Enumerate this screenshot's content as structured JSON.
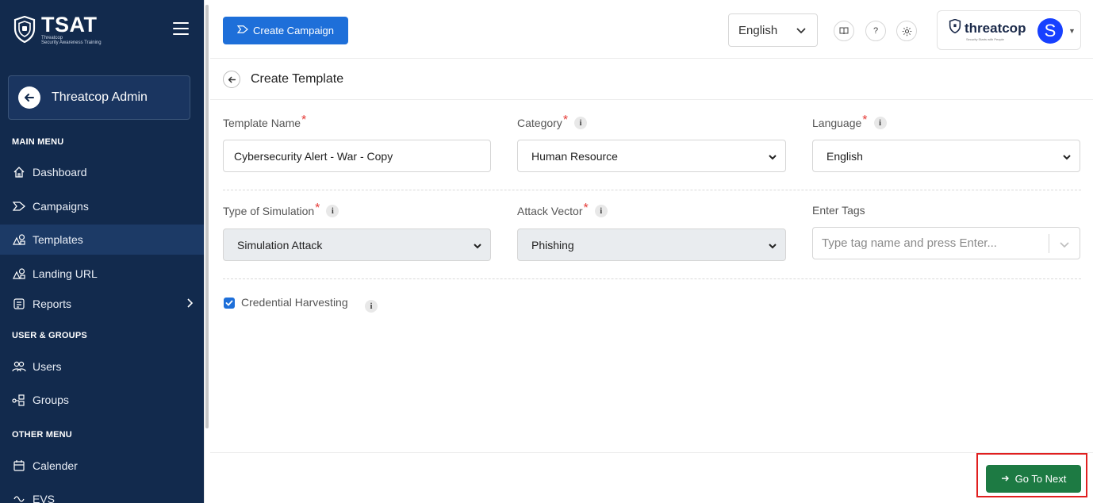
{
  "brand": {
    "name": "TSAT",
    "sub_line1": "Threatcop",
    "sub_line2": "Security Awareness Training"
  },
  "admin": {
    "label": "Threatcop Admin"
  },
  "sidebar": {
    "main_heading": "MAIN MENU",
    "main_items": [
      {
        "label": "Dashboard",
        "icon": "home-icon"
      },
      {
        "label": "Campaigns",
        "icon": "campaign-icon"
      },
      {
        "label": "Templates",
        "icon": "templates-icon",
        "active": true
      },
      {
        "label": "Landing URL",
        "icon": "landing-icon"
      },
      {
        "label": "Reports",
        "icon": "reports-icon"
      }
    ],
    "users_heading": "USER & GROUPS",
    "users_items": [
      {
        "label": "Users",
        "icon": "users-icon"
      },
      {
        "label": "Groups",
        "icon": "groups-icon"
      }
    ],
    "other_heading": "OTHER MENU",
    "other_items": [
      {
        "label": "Calender",
        "icon": "calendar-icon"
      },
      {
        "label": "EVS",
        "icon": "evs-icon"
      }
    ]
  },
  "topbar": {
    "create_campaign": "Create Campaign",
    "language": "English",
    "help": "?",
    "company": "threatcop",
    "company_tagline": "Security Starts with People",
    "avatar_initial": "S"
  },
  "page": {
    "title": "Create Template"
  },
  "form": {
    "template_name_label": "Template Name",
    "template_name_value": "Cybersecurity Alert - War - Copy",
    "category_label": "Category",
    "category_value": "Human Resource",
    "language_label": "Language",
    "language_value": "English",
    "simulation_label": "Type of Simulation",
    "simulation_value": "Simulation Attack",
    "vector_label": "Attack Vector",
    "vector_value": "Phishing",
    "tags_label": "Enter Tags",
    "tags_placeholder": "Type tag name and press Enter...",
    "credential_label": "Credential Harvesting",
    "credential_checked": true,
    "required_mark": "*",
    "info_glyph": "i"
  },
  "footer": {
    "next_label": "Go To Next"
  },
  "colors": {
    "sidebar": "#122a4d",
    "primary": "#1e6fd9",
    "success": "#1d7a43",
    "highlight": "#e01f1f",
    "required": "#e53935"
  }
}
